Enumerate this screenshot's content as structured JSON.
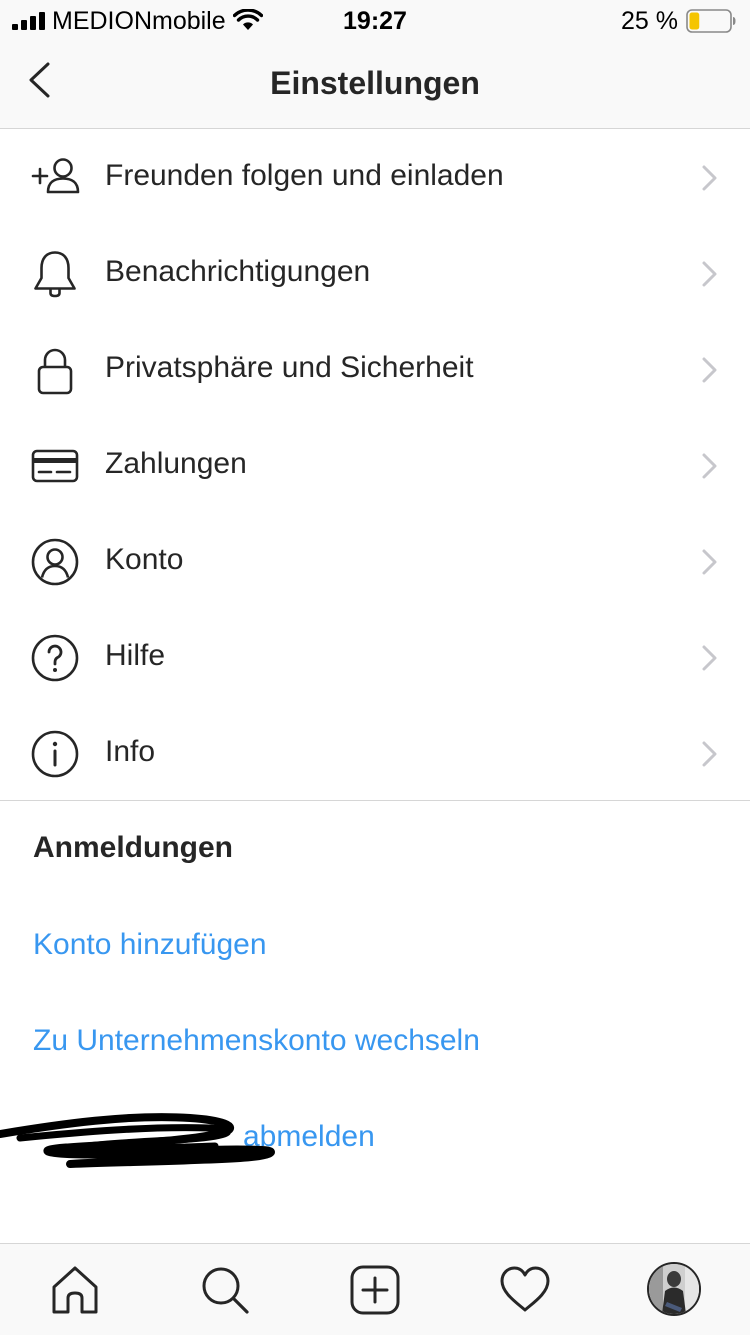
{
  "status_bar": {
    "carrier": "MEDIONmobile",
    "time": "19:27",
    "battery_percent": "25 %",
    "battery_level": 0.25,
    "battery_color": "#f5c500"
  },
  "nav": {
    "title": "Einstellungen",
    "back_icon": "chevron-left-icon"
  },
  "settings_items": [
    {
      "label": "Freunden folgen und einladen",
      "icon": "add-person-icon"
    },
    {
      "label": "Benachrichtigungen",
      "icon": "bell-icon"
    },
    {
      "label": "Privatsphäre und Sicherheit",
      "icon": "lock-icon"
    },
    {
      "label": "Zahlungen",
      "icon": "credit-card-icon"
    },
    {
      "label": "Konto",
      "icon": "account-icon"
    },
    {
      "label": "Hilfe",
      "icon": "help-icon"
    },
    {
      "label": "Info",
      "icon": "info-icon"
    }
  ],
  "logins": {
    "header": "Anmeldungen",
    "add_account": "Konto hinzufügen",
    "switch_business": "Zu Unternehmenskonto wechseln",
    "logout_suffix": "abmelden"
  },
  "tab_bar": {
    "items": [
      "home-icon",
      "search-icon",
      "new-post-icon",
      "heart-icon",
      "profile-avatar"
    ]
  },
  "colors": {
    "link": "#3897f0",
    "text": "#262626",
    "chevron": "#c7c7cc",
    "bar_background": "#f9f9f9"
  }
}
